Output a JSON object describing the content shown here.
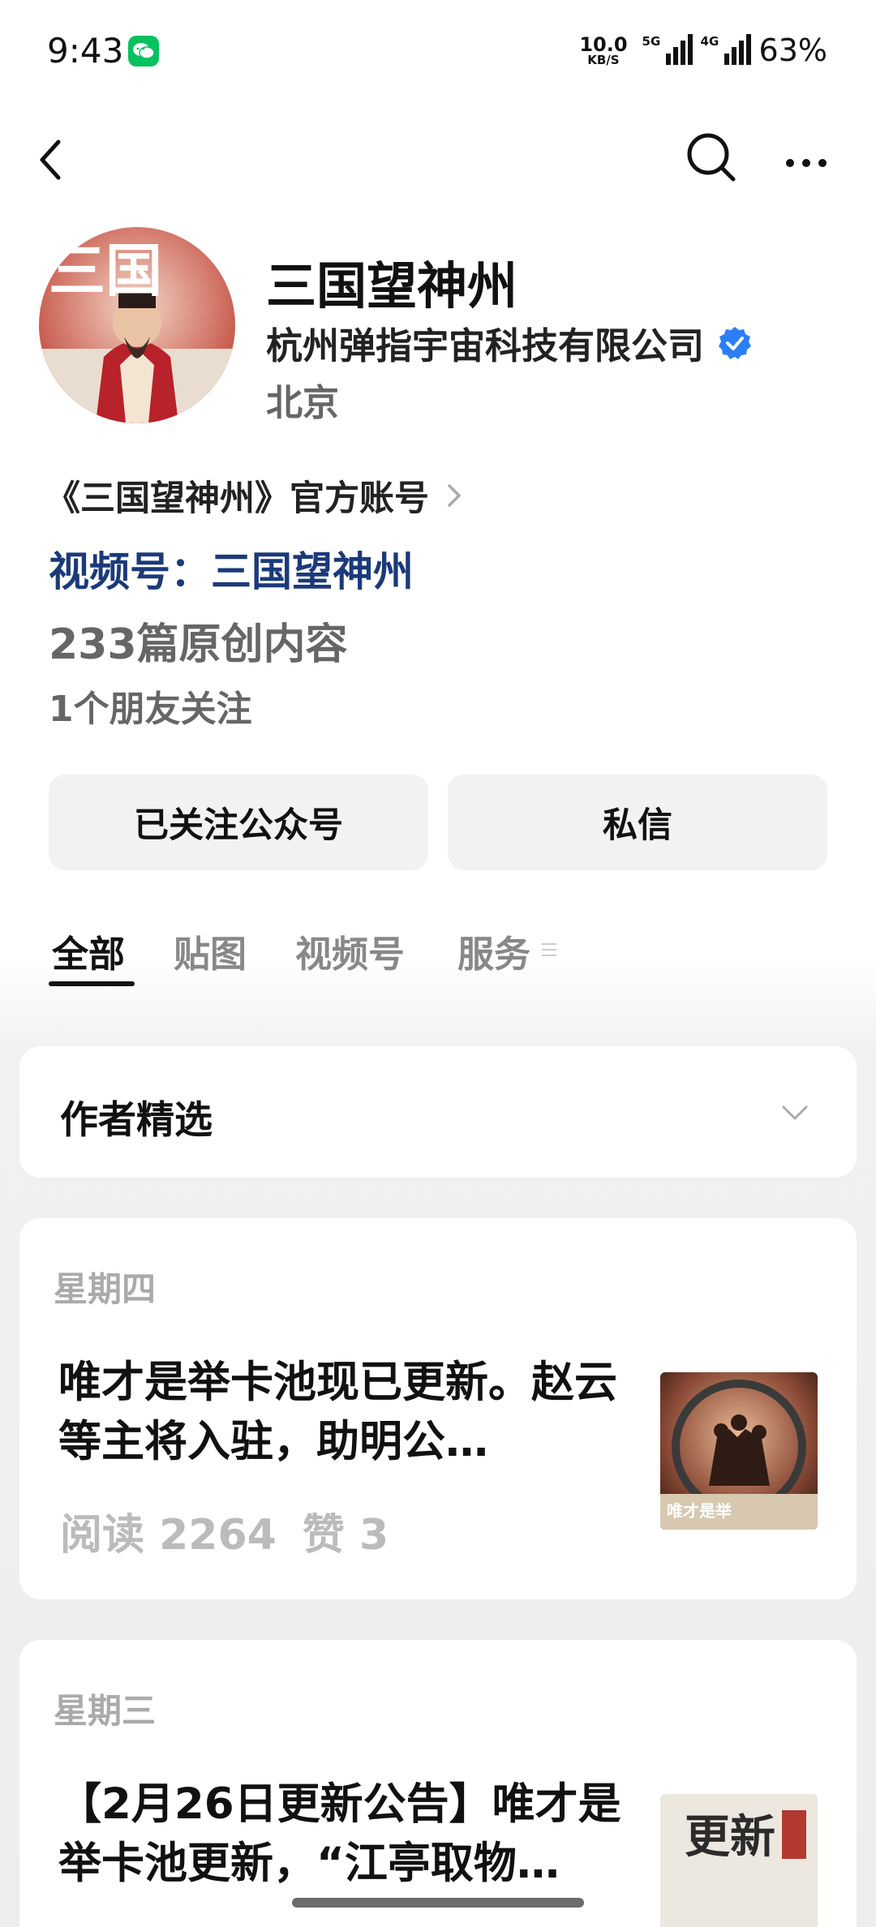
{
  "status": {
    "time": "9:43",
    "speed_value": "10.0",
    "speed_unit": "KB/S",
    "net1_label": "5G",
    "net2_label": "4G",
    "battery": "63%"
  },
  "nav": {
    "back_icon": "chevron-left-icon",
    "search_icon": "search-icon",
    "more_icon": "more-icon"
  },
  "profile": {
    "name": "三国望神州",
    "company": "杭州弹指宇宙科技有限公司",
    "location": "北京",
    "description": "《三国望神州》官方账号",
    "video_channel": "视频号：三国望神州",
    "article_count": "233篇原创内容",
    "friends": "1个朋友关注",
    "avatar_text": "三国"
  },
  "buttons": {
    "follow": "已关注公众号",
    "message": "私信"
  },
  "tabs": [
    {
      "label": "全部",
      "active": true
    },
    {
      "label": "贴图",
      "active": false
    },
    {
      "label": "视频号",
      "active": false
    },
    {
      "label": "服务",
      "active": false
    }
  ],
  "selection": {
    "title": "作者精选"
  },
  "posts": [
    {
      "day": "星期四",
      "title": "唯才是举卡池现已更新。赵云等主将入驻，助明公…",
      "reads": "阅读 2264",
      "likes": "赞 3",
      "thumb_text": "唯才是举"
    },
    {
      "day": "星期三",
      "title": "【2月26日更新公告】唯才是举卡池更新，“江亭取物…",
      "thumb_text": "更新"
    }
  ],
  "colors": {
    "link": "#1b3a7a",
    "verified": "#2b7ff6",
    "wechat": "#07c160"
  }
}
